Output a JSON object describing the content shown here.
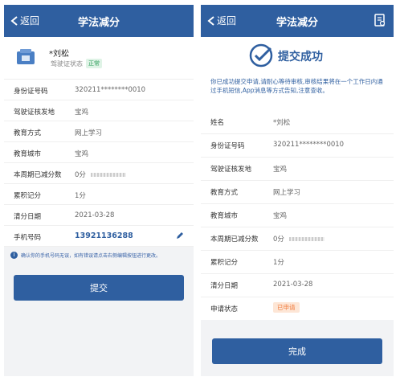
{
  "colors": {
    "primary": "#2f5fa0",
    "status_green": "#2e9e5b",
    "status_orange": "#f07a3b"
  },
  "left": {
    "header": {
      "back_label": "返回",
      "title": "学法减分"
    },
    "user": {
      "name": "*刘松",
      "license_status_label": "驾驶证状态",
      "license_status": "正常"
    },
    "rows": [
      {
        "key": "身份证号码",
        "value": "320211********0010"
      },
      {
        "key": "驾驶证核发地",
        "value": "宝鸡"
      },
      {
        "key": "教育方式",
        "value": "网上学习"
      },
      {
        "key": "教育城市",
        "value": "宝鸡"
      },
      {
        "key": "本周期已减分数",
        "value": "0分"
      },
      {
        "key": "累积记分",
        "value": "1分"
      },
      {
        "key": "清分日期",
        "value": "2021-03-28"
      },
      {
        "key": "手机号码",
        "value": "13921136288"
      }
    ],
    "notice": "确认你的手机号码无误，如有错误请点击右侧编辑按钮进行更改。",
    "submit_label": "提交"
  },
  "right": {
    "header": {
      "back_label": "返回",
      "title": "学法减分"
    },
    "success_title": "提交成功",
    "success_desc": "你已成功提交申请,请耐心等待审核,审核结果将在一个工作日内通过手机短信,App消息等方式告知,注意查收。",
    "rows": [
      {
        "key": "姓名",
        "value": "*刘松"
      },
      {
        "key": "身份证号码",
        "value": "320211********0010"
      },
      {
        "key": "驾驶证核发地",
        "value": "宝鸡"
      },
      {
        "key": "教育方式",
        "value": "网上学习"
      },
      {
        "key": "教育城市",
        "value": "宝鸡"
      },
      {
        "key": "本周期已减分数",
        "value": "0分"
      },
      {
        "key": "累积记分",
        "value": "1分"
      },
      {
        "key": "清分日期",
        "value": "2021-03-28"
      },
      {
        "key": "申请状态",
        "value": "已申请"
      }
    ],
    "done_label": "完成"
  }
}
